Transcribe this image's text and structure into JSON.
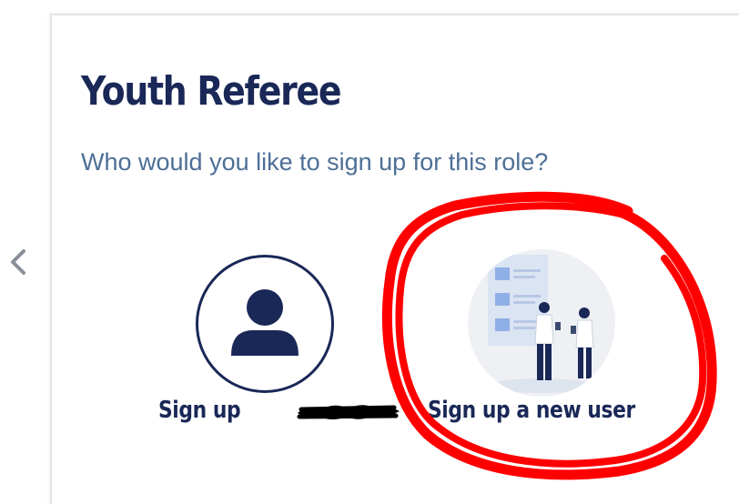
{
  "card": {
    "title": "Youth Referee",
    "subtitle": "Who would you like to sign up for this role?"
  },
  "options": [
    {
      "label": "Sign up ",
      "icon": "user-icon"
    },
    {
      "label": "Sign up a new user",
      "icon": "people-illustration-icon"
    }
  ],
  "nav": {
    "back_icon": "chevron-left-icon"
  },
  "colors": {
    "title": "#1a2857",
    "subtitle": "#4d6f96",
    "annotation": "#ff0000"
  }
}
